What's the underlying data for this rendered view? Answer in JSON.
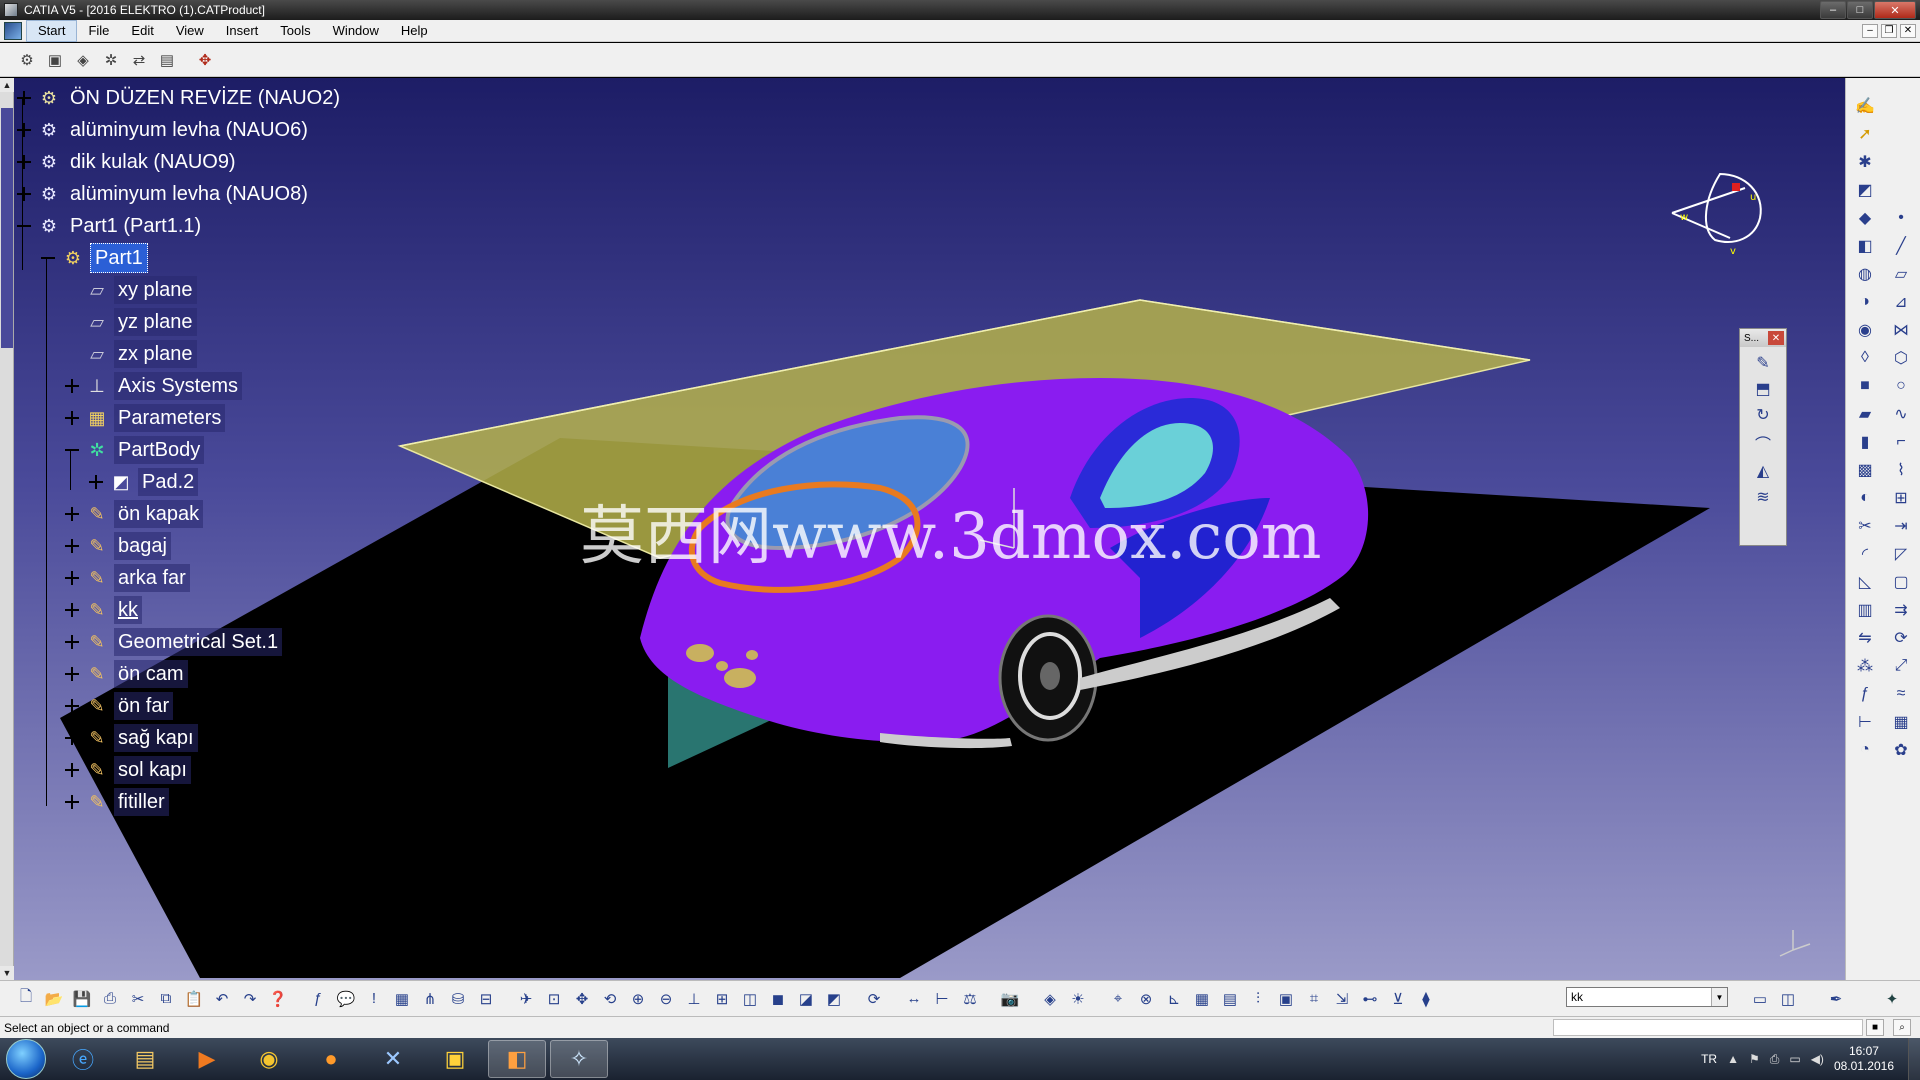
{
  "window": {
    "title": "CATIA V5 - [2016 ELEKTRO (1).CATProduct]",
    "minimize": "–",
    "maximize": "□",
    "close": "✕"
  },
  "menu": {
    "items": [
      "Start",
      "File",
      "Edit",
      "View",
      "Insert",
      "Tools",
      "Window",
      "Help"
    ],
    "active": "Start"
  },
  "tree": {
    "nodes": [
      {
        "label": "ÖN DÜZEN REVİZE (NAUO2)",
        "toggle": "plus",
        "icon": "assembly-icon"
      },
      {
        "label": "alüminyum levha (NAUO6)",
        "toggle": "plus",
        "icon": "part-instance-icon"
      },
      {
        "label": "dik kulak (NAUO9)",
        "toggle": "plus",
        "icon": "part-instance-icon"
      },
      {
        "label": "alüminyum levha (NAUO8)",
        "toggle": "plus",
        "icon": "part-instance-icon"
      },
      {
        "label": "Part1 (Part1.1)",
        "toggle": "minus",
        "icon": "part-instance-icon"
      },
      {
        "label": "Part1",
        "toggle": "minus",
        "icon": "part-icon",
        "selected": true
      },
      {
        "label": "xy plane",
        "icon": "plane-icon"
      },
      {
        "label": "yz plane",
        "icon": "plane-icon"
      },
      {
        "label": "zx plane",
        "icon": "plane-icon"
      },
      {
        "label": "Axis Systems",
        "toggle": "plus",
        "icon": "axis-icon"
      },
      {
        "label": "Parameters",
        "toggle": "plus",
        "icon": "parameters-icon"
      },
      {
        "label": "PartBody",
        "toggle": "minus",
        "icon": "partbody-icon"
      },
      {
        "label": "Pad.2",
        "toggle": "plus",
        "icon": "pad-icon"
      },
      {
        "label": "ön kapak",
        "toggle": "plus",
        "icon": "geometrical-set-icon"
      },
      {
        "label": "bagaj",
        "toggle": "plus",
        "icon": "geometrical-set-icon"
      },
      {
        "label": "arka far",
        "toggle": "plus",
        "icon": "geometrical-set-icon"
      },
      {
        "label": "kk",
        "toggle": "plus",
        "icon": "geometrical-set-icon",
        "underline": true
      },
      {
        "label": "Geometrical Set.1",
        "toggle": "plus",
        "icon": "geometrical-set-icon"
      },
      {
        "label": "ön cam",
        "toggle": "plus",
        "icon": "geometrical-set-icon"
      },
      {
        "label": "ön far",
        "toggle": "plus",
        "icon": "geometrical-set-icon"
      },
      {
        "label": "sağ kapı",
        "toggle": "plus",
        "icon": "geometrical-set-icon"
      },
      {
        "label": "sol kapı",
        "toggle": "plus",
        "icon": "geometrical-set-icon"
      },
      {
        "label": "fitiller",
        "toggle": "plus",
        "icon": "geometrical-set-icon"
      }
    ]
  },
  "viewport": {
    "watermark": "莫西网www.3dmox.com",
    "compass_labels": [
      "u",
      "v",
      "w"
    ]
  },
  "float_toolbar": {
    "title": "S...",
    "close": "✕"
  },
  "bottom_toolbar": {
    "layer_value": "kk"
  },
  "status": {
    "message": "Select an object or a command"
  },
  "taskbar": {
    "language": "TR",
    "time": "16:07",
    "date": "08.01.2016"
  },
  "colors": {
    "background_top": "#1d1d66",
    "background_bottom": "#9a9ac8",
    "car_body": "#8a1cf0",
    "plane": "#b5b24a",
    "selection": "#2b5fd6"
  }
}
